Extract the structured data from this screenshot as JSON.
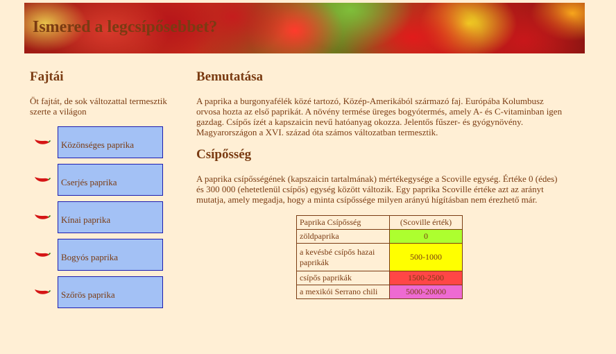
{
  "header": {
    "title": "Ismered a legcsípősebbet?"
  },
  "left": {
    "heading": "Fajtái",
    "intro": "Öt fajtát, de sok változattal termesztik szerte a világon",
    "pepper_icon": "chili-pepper-icon",
    "varieties": [
      {
        "label": "Közönséges paprika"
      },
      {
        "label": "Cserjés paprika"
      },
      {
        "label": "Kínai paprika"
      },
      {
        "label": "Bogyós paprika"
      },
      {
        "label": "Szőrös paprika"
      }
    ]
  },
  "main": {
    "heading1": "Bemutatása",
    "para1": "A paprika a burgonyafélék közé tartozó, Közép-Amerikából származó faj. Európába Kolumbusz orvosa hozta az első paprikát. A növény termése üreges bogyótermés, amely A- és C-vitaminban igen gazdag. Csípős ízét a kapszaicin nevű hatóanyag okozza. Jelentős fűszer- és gyógynövény. Magyarországon a XVI. század óta számos változatban termesztik.",
    "heading2": "Csípősség",
    "para2": "A paprika csípősségének (kapszaicin tartalmának) mértékegysége a Scoville egység. Értéke 0 (édes) és 300 000 (ehetetlenül csípős) egység között változik. Egy paprika Scoville értéke azt az arányt mutatja, amely megadja, hogy a minta csípőssége milyen arányú hígításban nem érezhető már.",
    "table": {
      "header": [
        "Paprika Csípősség",
        "(Scoville érték)"
      ],
      "rows": [
        {
          "name": "zöldpaprika",
          "value": "0",
          "color": "#adff2f"
        },
        {
          "name": "a kevésbé csípős hazai paprikák",
          "value": "500-1000",
          "color": "#ffff00"
        },
        {
          "name": "csípős paprikák",
          "value": "1500-2500",
          "color": "#ff4646"
        },
        {
          "name": "a mexikói Serrano chili",
          "value": "5000-20000",
          "color": "#ee6ad2"
        }
      ]
    }
  }
}
